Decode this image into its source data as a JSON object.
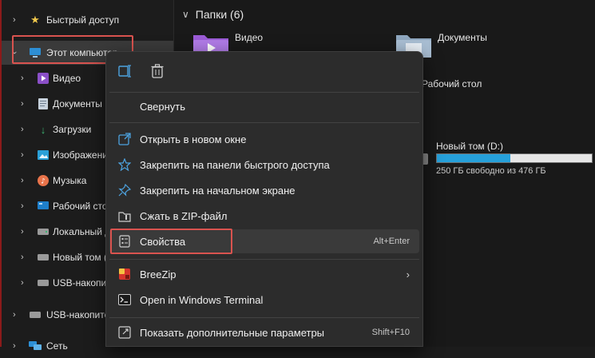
{
  "sidebar": {
    "items": [
      {
        "label": "Быстрый доступ",
        "icon": "star-icon"
      },
      {
        "label": "Этот компьютер",
        "icon": "monitor-icon"
      },
      {
        "label": "Видео",
        "icon": "video-icon"
      },
      {
        "label": "Документы",
        "icon": "document-icon"
      },
      {
        "label": "Загрузки",
        "icon": "download-icon"
      },
      {
        "label": "Изображения",
        "icon": "image-icon"
      },
      {
        "label": "Музыка",
        "icon": "music-icon"
      },
      {
        "label": "Рабочий стол",
        "icon": "desktop-icon"
      },
      {
        "label": "Локальный диск",
        "icon": "drive-icon"
      },
      {
        "label": "Новый том (D:)",
        "icon": "drive-icon"
      },
      {
        "label": "USB-накопитель",
        "icon": "usb-drive-icon"
      },
      {
        "label": "USB-накопитель",
        "icon": "usb-drive-icon"
      },
      {
        "label": "Сеть",
        "icon": "network-icon"
      }
    ]
  },
  "main": {
    "group_header": "Папки (6)",
    "folders": [
      {
        "name": "Видео",
        "icon": "video-folder-icon"
      },
      {
        "name": "Документы",
        "icon": "documents-folder-icon"
      },
      {
        "name": "Рабочий стол",
        "icon": "desktop-folder-icon"
      }
    ],
    "drive": {
      "name": "Новый том (D:)",
      "free_text": "250 ГБ свободно из 476 ГБ",
      "used_fraction": 0.475
    }
  },
  "menu": {
    "quick_actions": [
      {
        "name": "rename-icon"
      },
      {
        "name": "trash-icon"
      }
    ],
    "items": [
      {
        "label": "Свернуть",
        "icon": "",
        "key": ""
      },
      {
        "label": "Открыть в новом окне",
        "icon": "open-new-window-icon",
        "key": ""
      },
      {
        "label": "Закрепить на панели быстрого доступа",
        "icon": "star-outline-icon",
        "key": ""
      },
      {
        "label": "Закрепить на начальном экране",
        "icon": "pin-icon",
        "key": ""
      },
      {
        "label": "Сжать в ZIP-файл",
        "icon": "zip-icon",
        "key": ""
      },
      {
        "label": "Свойства",
        "icon": "properties-icon",
        "key": "Alt+Enter"
      },
      {
        "label": "BreeZip",
        "icon": "breezip-icon",
        "key": ""
      },
      {
        "label": "Open in Windows Terminal",
        "icon": "terminal-icon",
        "key": ""
      },
      {
        "label": "Показать дополнительные параметры",
        "icon": "more-options-icon",
        "key": "Shift+F10"
      }
    ]
  },
  "colors": {
    "accent": "#26a0da",
    "highlight": "#d9534f",
    "menu_bg": "#2c2c2c",
    "window_bg": "#1c1c1c"
  }
}
